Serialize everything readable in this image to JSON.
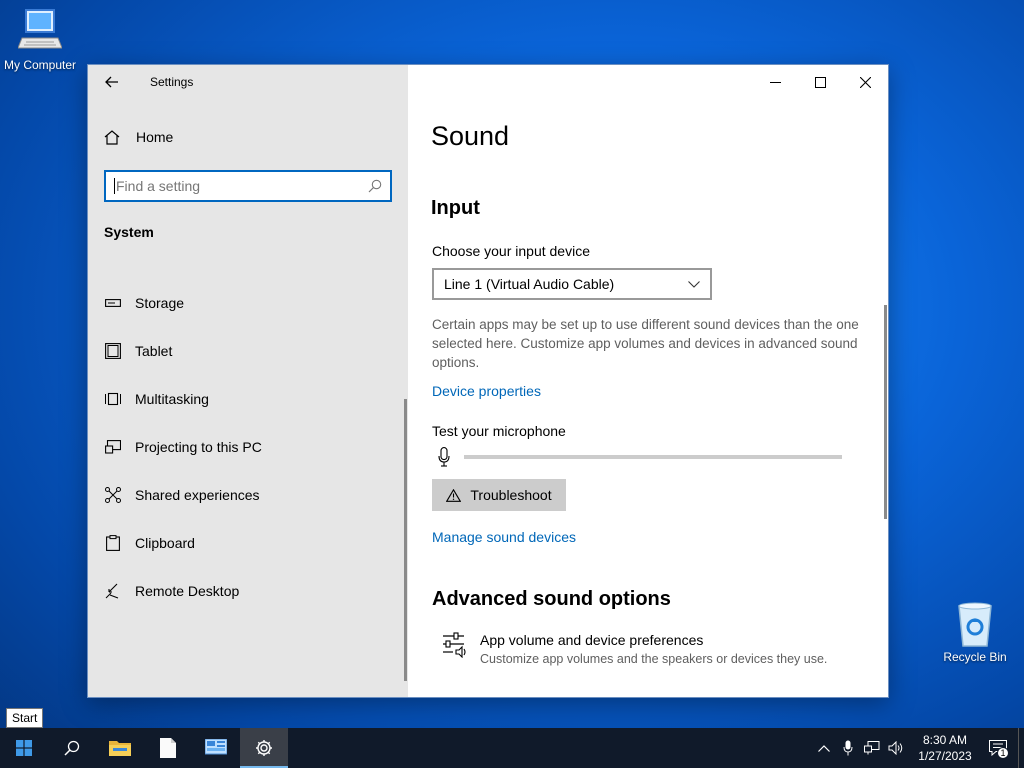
{
  "desktop": {
    "icons": [
      {
        "label": "My Computer"
      },
      {
        "label": "Recycle Bin"
      }
    ]
  },
  "window": {
    "title": "Settings",
    "sidebar": {
      "home_label": "Home",
      "search_placeholder": "Find a setting",
      "section": "System",
      "items": [
        {
          "label": "Storage",
          "icon": "storage-icon"
        },
        {
          "label": "Tablet",
          "icon": "tablet-icon"
        },
        {
          "label": "Multitasking",
          "icon": "multitasking-icon"
        },
        {
          "label": "Projecting to this PC",
          "icon": "projecting-icon"
        },
        {
          "label": "Shared experiences",
          "icon": "shared-experiences-icon"
        },
        {
          "label": "Clipboard",
          "icon": "clipboard-icon"
        },
        {
          "label": "Remote Desktop",
          "icon": "remote-desktop-icon"
        }
      ]
    },
    "main": {
      "page_title": "Sound",
      "input_heading": "Input",
      "choose_device_label": "Choose your input device",
      "selected_device": "Line 1 (Virtual Audio Cable)",
      "description": "Certain apps may be set up to use different sound devices than the one selected here. Customize app volumes and devices in advanced sound options.",
      "device_properties_link": "Device properties",
      "test_mic_label": "Test your microphone",
      "mic_level": 0,
      "troubleshoot_label": "Troubleshoot",
      "manage_devices_link": "Manage sound devices",
      "advanced_heading": "Advanced sound options",
      "app_volume_title": "App volume and device preferences",
      "app_volume_desc": "Customize app volumes and the speakers or devices they use."
    }
  },
  "tooltip": "Start",
  "taskbar": {
    "time": "8:30 AM",
    "date": "1/27/2023",
    "notification_count": "1"
  },
  "colors": {
    "accent": "#0067c0",
    "link": "#0067b8",
    "sidebar_bg": "#e6e6e6",
    "taskbar_bg": "#101a2a"
  }
}
